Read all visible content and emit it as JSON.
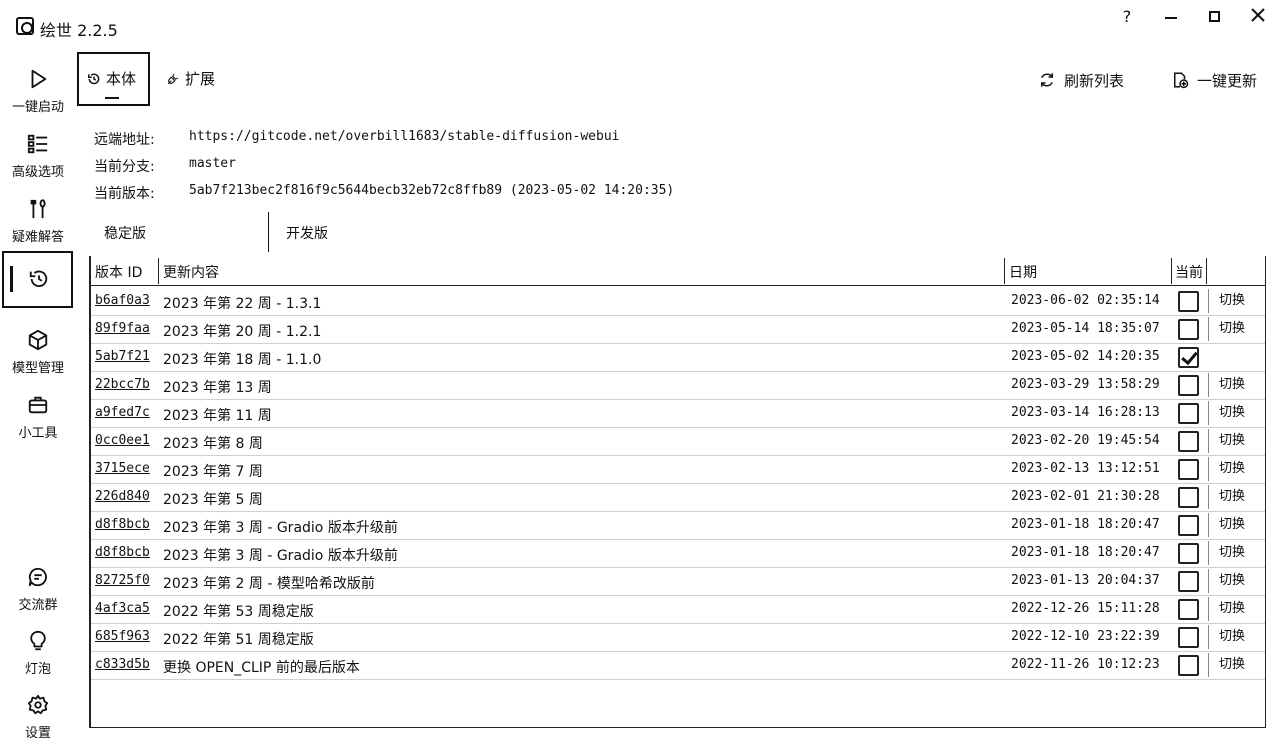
{
  "window": {
    "title": "绘世 2.2.5",
    "help_icon": "?"
  },
  "sidebar": {
    "items": [
      {
        "label": "一键启动",
        "icon": "play-icon"
      },
      {
        "label": "高级选项",
        "icon": "list-icon"
      },
      {
        "label": "疑难解答",
        "icon": "tools-icon"
      },
      {
        "label": "",
        "icon": "history-icon"
      },
      {
        "label": "模型管理",
        "icon": "cube-icon"
      },
      {
        "label": "小工具",
        "icon": "toolbox-icon"
      },
      {
        "label": "交流群",
        "icon": "chat-icon"
      },
      {
        "label": "灯泡",
        "icon": "bulb-icon"
      },
      {
        "label": "设置",
        "icon": "gear-icon"
      }
    ]
  },
  "tabs": {
    "main": "本体",
    "extensions": "扩展"
  },
  "actions": {
    "refresh": "刷新列表",
    "update": "一键更新"
  },
  "info": {
    "remote_label": "远端地址:",
    "remote_value": "https://gitcode.net/overbill1683/stable-diffusion-webui",
    "branch_label": "当前分支:",
    "branch_value": "master",
    "version_label": "当前版本:",
    "version_value": "5ab7f213bec2f816f9c5644becb32eb72c8ffb89 (2023-05-02 14:20:35)"
  },
  "subtabs": {
    "stable": "稳定版",
    "dev": "开发版"
  },
  "table": {
    "headers": {
      "id": "版本 ID",
      "content": "更新内容",
      "date": "日期",
      "current": "当前"
    },
    "switch_label": "切换",
    "rows": [
      {
        "id": "b6af0a3",
        "msg": "2023 年第 22 周 - 1.3.1",
        "date": "2023-06-02 02:35:14",
        "current": false
      },
      {
        "id": "89f9faa",
        "msg": "2023 年第 20 周 - 1.2.1",
        "date": "2023-05-14 18:35:07",
        "current": false
      },
      {
        "id": "5ab7f21",
        "msg": "2023 年第 18 周 - 1.1.0",
        "date": "2023-05-02 14:20:35",
        "current": true
      },
      {
        "id": "22bcc7b",
        "msg": "2023 年第 13 周",
        "date": "2023-03-29 13:58:29",
        "current": false
      },
      {
        "id": "a9fed7c",
        "msg": "2023 年第 11 周",
        "date": "2023-03-14 16:28:13",
        "current": false
      },
      {
        "id": "0cc0ee1",
        "msg": "2023 年第 8 周",
        "date": "2023-02-20 19:45:54",
        "current": false
      },
      {
        "id": "3715ece",
        "msg": "2023 年第 7 周",
        "date": "2023-02-13 13:12:51",
        "current": false
      },
      {
        "id": "226d840",
        "msg": "2023 年第 5 周",
        "date": "2023-02-01 21:30:28",
        "current": false
      },
      {
        "id": "d8f8bcb",
        "msg": "2023 年第 3 周 - Gradio 版本升级前",
        "date": "2023-01-18 18:20:47",
        "current": false
      },
      {
        "id": "d8f8bcb",
        "msg": "2023 年第 3 周 - Gradio 版本升级前",
        "date": "2023-01-18 18:20:47",
        "current": false
      },
      {
        "id": "82725f0",
        "msg": "2023 年第 2 周 - 模型哈希改版前",
        "date": "2023-01-13 20:04:37",
        "current": false
      },
      {
        "id": "4af3ca5",
        "msg": "2022 年第 53 周稳定版",
        "date": "2022-12-26 15:11:28",
        "current": false
      },
      {
        "id": "685f963",
        "msg": "2022 年第 51 周稳定版",
        "date": "2022-12-10 23:22:39",
        "current": false
      },
      {
        "id": "c833d5b",
        "msg": "更换 OPEN_CLIP 前的最后版本",
        "date": "2022-11-26 10:12:23",
        "current": false
      }
    ]
  }
}
